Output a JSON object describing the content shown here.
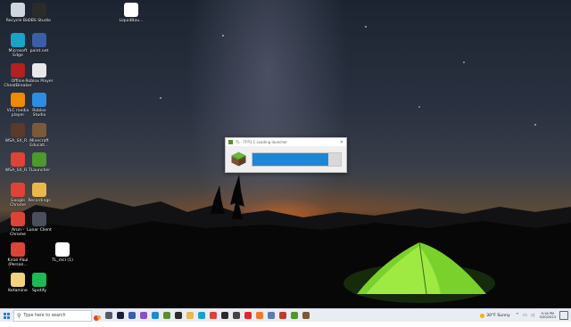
{
  "desktop": {
    "icons": [
      {
        "label": "Recycle Bin",
        "icon": "recycle-bin-icon",
        "color": "#cfd6de"
      },
      {
        "label": "OBS Studio",
        "icon": "obs-studio-icon",
        "color": "#2b2b2b"
      },
      {
        "label": "LiquidBou...",
        "icon": "java-file-icon",
        "color": "#ffffff"
      },
      {
        "label": "Microsoft\nEdge",
        "icon": "edge-icon",
        "color": "#1aa3c8"
      },
      {
        "label": "paint.net",
        "icon": "paint-net-icon",
        "color": "#3a5ea8"
      },
      {
        "label": "Offline\nCheatBreaker",
        "icon": "cheatbreaker-icon",
        "color": "#b32020"
      },
      {
        "label": "Roblox Player",
        "icon": "roblox-player-icon",
        "color": "#e8e8e8"
      },
      {
        "label": "VLC media\nplayer",
        "icon": "vlc-icon",
        "color": "#f08a00"
      },
      {
        "label": "Roblox\nStudio",
        "icon": "roblox-studio-icon",
        "color": "#2d8de0"
      },
      {
        "label": "WSA_SX_R...",
        "icon": "wsa-icon",
        "color": "#5a3a2a"
      },
      {
        "label": "Minecraft\nEducati...",
        "icon": "minecraft-education-icon",
        "color": "#7a5a3a"
      },
      {
        "label": "WSA_SX_R...",
        "icon": "chrome-icon",
        "color": "#db4437"
      },
      {
        "label": "TLauncher",
        "icon": "tlauncher-icon",
        "color": "#4c9a2a"
      },
      {
        "label": "Google\nChrome",
        "icon": "chrome-icon",
        "color": "#db4437"
      },
      {
        "label": "Recordings",
        "icon": "folder-icon",
        "color": "#e8b84a"
      },
      {
        "label": "Arun -\nChrome",
        "icon": "chrome-profile-icon",
        "color": "#db4437"
      },
      {
        "label": "Lunar Client",
        "icon": "lunar-client-icon",
        "color": "#4a4f5c"
      },
      {
        "label": "Kiran Paul\n(Person...",
        "icon": "chrome-profile-icon",
        "color": "#db4437"
      },
      {
        "label": "TL_mcl (1)",
        "icon": "java-file-icon",
        "color": "#ffffff"
      },
      {
        "label": "Ketamine",
        "icon": "file-icon",
        "color": "#f2d27a"
      },
      {
        "label": "Spotify",
        "icon": "spotify-icon",
        "color": "#1db954"
      }
    ]
  },
  "launcher": {
    "title": "TL - TFP1.1 Loading launcher",
    "close": "✕",
    "progress": 0.86,
    "progress_color": "#1f86d6"
  },
  "taskbar": {
    "search_placeholder": "Type here to search",
    "apps": [
      {
        "name": "task-view-icon",
        "color": "#555b66"
      },
      {
        "name": "cortana-icon",
        "color": "#1b1f3a"
      },
      {
        "name": "minecraft-dungeons-icon",
        "color": "#3b5fb0"
      },
      {
        "name": "visual-studio-icon",
        "color": "#8a4fc9"
      },
      {
        "name": "vscode-icon",
        "color": "#1d8ad4"
      },
      {
        "name": "minecraft-icon",
        "color": "#5a8f2e"
      },
      {
        "name": "terminal-icon",
        "color": "#2b2b2b"
      },
      {
        "name": "file-explorer-icon",
        "color": "#e8b84a"
      },
      {
        "name": "edge-icon",
        "color": "#1aa3c8"
      },
      {
        "name": "chrome-icon",
        "color": "#db4437"
      },
      {
        "name": "obs-icon",
        "color": "#2b2b2b"
      },
      {
        "name": "roblox-icon",
        "color": "#444444"
      },
      {
        "name": "opera-icon",
        "color": "#e3262e"
      },
      {
        "name": "chat-icon",
        "color": "#f07a2a"
      },
      {
        "name": "java-icon",
        "color": "#5a7ab0"
      },
      {
        "name": "app-icon",
        "color": "#c23b2a"
      },
      {
        "name": "tlauncher-icon",
        "color": "#4c9a2a"
      },
      {
        "name": "minecraft-launcher-icon",
        "color": "#7a5a3a"
      }
    ],
    "weather": "30°F  Sunny",
    "clock_time": "9:16 PM",
    "clock_date": "5/30/2023"
  }
}
